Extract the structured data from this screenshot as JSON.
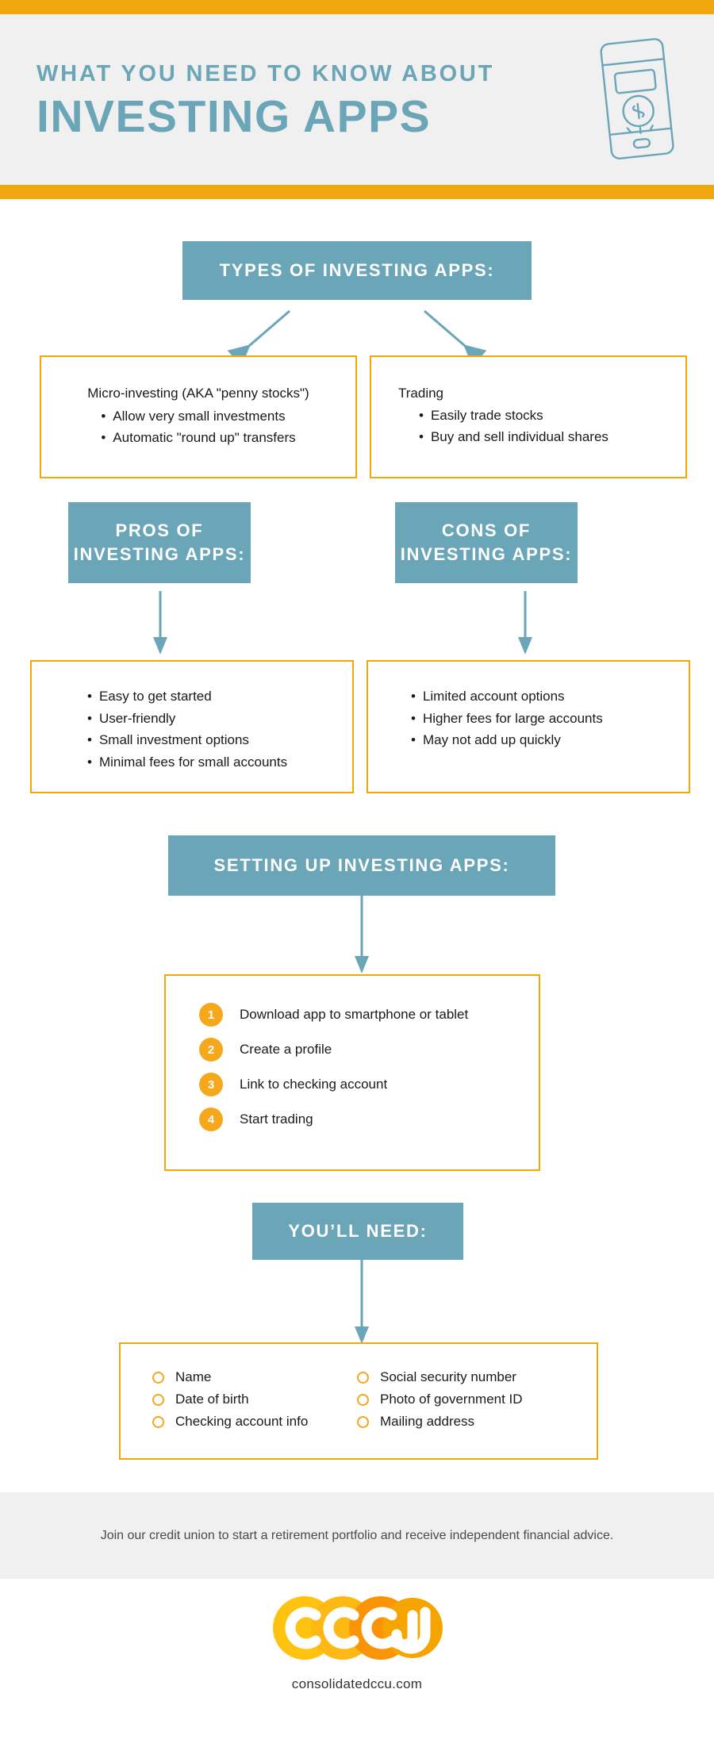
{
  "colors": {
    "orange": "#F0A80C",
    "teal": "#6BA5B8",
    "header_bg": "#F0F0F0",
    "logo_yellow": "#FFC20E",
    "logo_orange": "#F89406",
    "step_orange": "#F5A81C"
  },
  "header": {
    "kicker": "WHAT YOU NEED TO KNOW ABOUT",
    "title": "INVESTING APPS",
    "icon": "smartphone-dollar-icon"
  },
  "types": {
    "heading": "TYPES OF INVESTING APPS:",
    "left": {
      "lead": "Micro-investing (AKA \"penny stocks\")",
      "bullets": [
        "Allow very small investments",
        "Automatic \"round up\" transfers"
      ]
    },
    "right": {
      "lead": "Trading",
      "bullets": [
        "Easily trade stocks",
        "Buy and sell individual shares"
      ]
    }
  },
  "pros": {
    "heading_line1": "PROS OF",
    "heading_line2": "INVESTING APPS:",
    "bullets": [
      "Easy to get started",
      "User-friendly",
      "Small investment options",
      "Minimal fees for small accounts"
    ]
  },
  "cons": {
    "heading_line1": "CONS OF",
    "heading_line2": "INVESTING APPS:",
    "bullets": [
      "Limited account options",
      "Higher fees for large accounts",
      "May not add up quickly"
    ]
  },
  "setup": {
    "heading": "SETTING UP INVESTING APPS:",
    "steps": [
      {
        "number": "1",
        "label": "Download app to smartphone or tablet"
      },
      {
        "number": "2",
        "label": "Create a profile"
      },
      {
        "number": "3",
        "label": "Link to checking account"
      },
      {
        "number": "4",
        "label": "Start trading"
      }
    ]
  },
  "need": {
    "heading": "YOU’LL NEED:",
    "column_left": [
      "Name",
      "Date of birth",
      "Checking account info"
    ],
    "column_right": [
      "Social security number",
      "Photo of government ID",
      "Mailing address"
    ]
  },
  "footer": {
    "tagline": "Join our credit union to start a retirement portfolio and receive independent financial advice.",
    "logo_text": "CCCU",
    "url": "consolidatedccu.com"
  }
}
